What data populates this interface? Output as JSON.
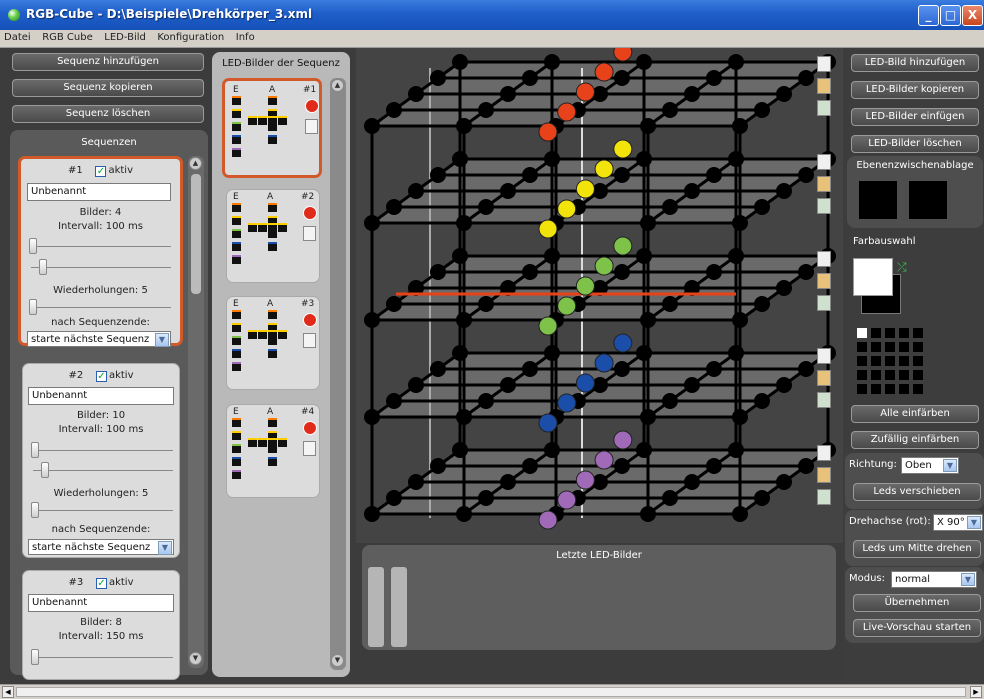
{
  "window": {
    "title": "RGB-Cube - D:\\Beispiele\\Drehkörper_3.xml",
    "min": "_",
    "max": "□",
    "close": "X"
  },
  "menu": [
    "Datei",
    "RGB Cube",
    "LED-Bild",
    "Konfiguration",
    "Info"
  ],
  "left_buttons": [
    "Sequenz hinzufügen",
    "Sequenz kopieren",
    "Sequenz löschen"
  ],
  "sequences_title": "Sequenzen",
  "sequences": [
    {
      "num": "#1",
      "active_label": "aktiv",
      "name": "Unbenannt",
      "bilder": "Bilder: 4",
      "intervall": "Intervall: 100 ms",
      "wiederholungen": "Wiederholungen: 5",
      "after_label": "nach Sequenzende:",
      "after_value": "starte nächste Sequenz"
    },
    {
      "num": "#2",
      "active_label": "aktiv",
      "name": "Unbenannt",
      "bilder": "Bilder: 10",
      "intervall": "Intervall: 100 ms",
      "wiederholungen": "Wiederholungen: 5",
      "after_label": "nach Sequenzende:",
      "after_value": "starte nächste Sequenz"
    },
    {
      "num": "#3",
      "active_label": "aktiv",
      "name": "Unbenannt",
      "bilder": "Bilder: 8",
      "intervall": "Intervall: 150 ms"
    }
  ],
  "ledbilder_title": "LED-Bilder der Sequenz",
  "ledbilder": [
    {
      "e": "E",
      "a": "A",
      "num": "#1"
    },
    {
      "e": "E",
      "a": "A",
      "num": "#2"
    },
    {
      "e": "E",
      "a": "A",
      "num": "#3"
    },
    {
      "e": "E",
      "a": "A",
      "num": "#4"
    }
  ],
  "letzte_title": "Letzte LED-Bilder",
  "right": {
    "buttons_top": [
      "LED-Bild hinzufügen",
      "LED-Bilder kopieren",
      "LED-Bilder einfügen",
      "LED-Bilder löschen"
    ],
    "ebenen_title": "Ebenenzwischenablage",
    "farbauswahl": "Farbauswahl",
    "alle_einfaerben": "Alle einfärben",
    "zufaellig": "Zufällig einfärben",
    "richtung_label": "Richtung:",
    "richtung_value": "Oben",
    "leds_verschieben": "Leds verschieben",
    "drehachse_label": "Drehachse (rot):",
    "drehachse_value": "X 90°",
    "leds_drehen": "Leds um Mitte drehen",
    "modus_label": "Modus:",
    "modus_value": "normal",
    "uebernehmen": "Übernehmen",
    "live": "Live-Vorschau starten"
  },
  "colors": {
    "accent_orange": "#d25a2a",
    "red": "#e8421a",
    "yellow": "#f2e40a",
    "green": "#7ec24a",
    "blue": "#1a4ea8",
    "purple": "#a06ab8"
  }
}
